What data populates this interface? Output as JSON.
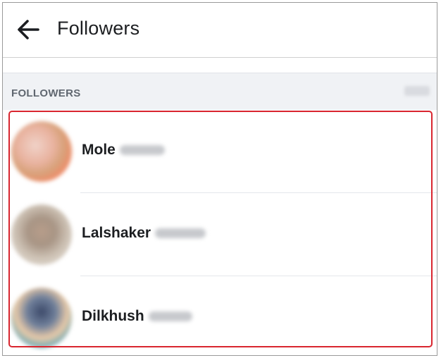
{
  "header": {
    "title": "Followers",
    "back_icon": "arrow-left-icon"
  },
  "section": {
    "title": "FOLLOWERS"
  },
  "followers": [
    {
      "name": "Mole"
    },
    {
      "name": "Lalshaker"
    },
    {
      "name": "Dilkhush"
    }
  ],
  "colors": {
    "highlight_border": "#d9262f",
    "section_background": "#f0f2f5",
    "name_text": "#1c1e21",
    "section_text": "#606770"
  }
}
